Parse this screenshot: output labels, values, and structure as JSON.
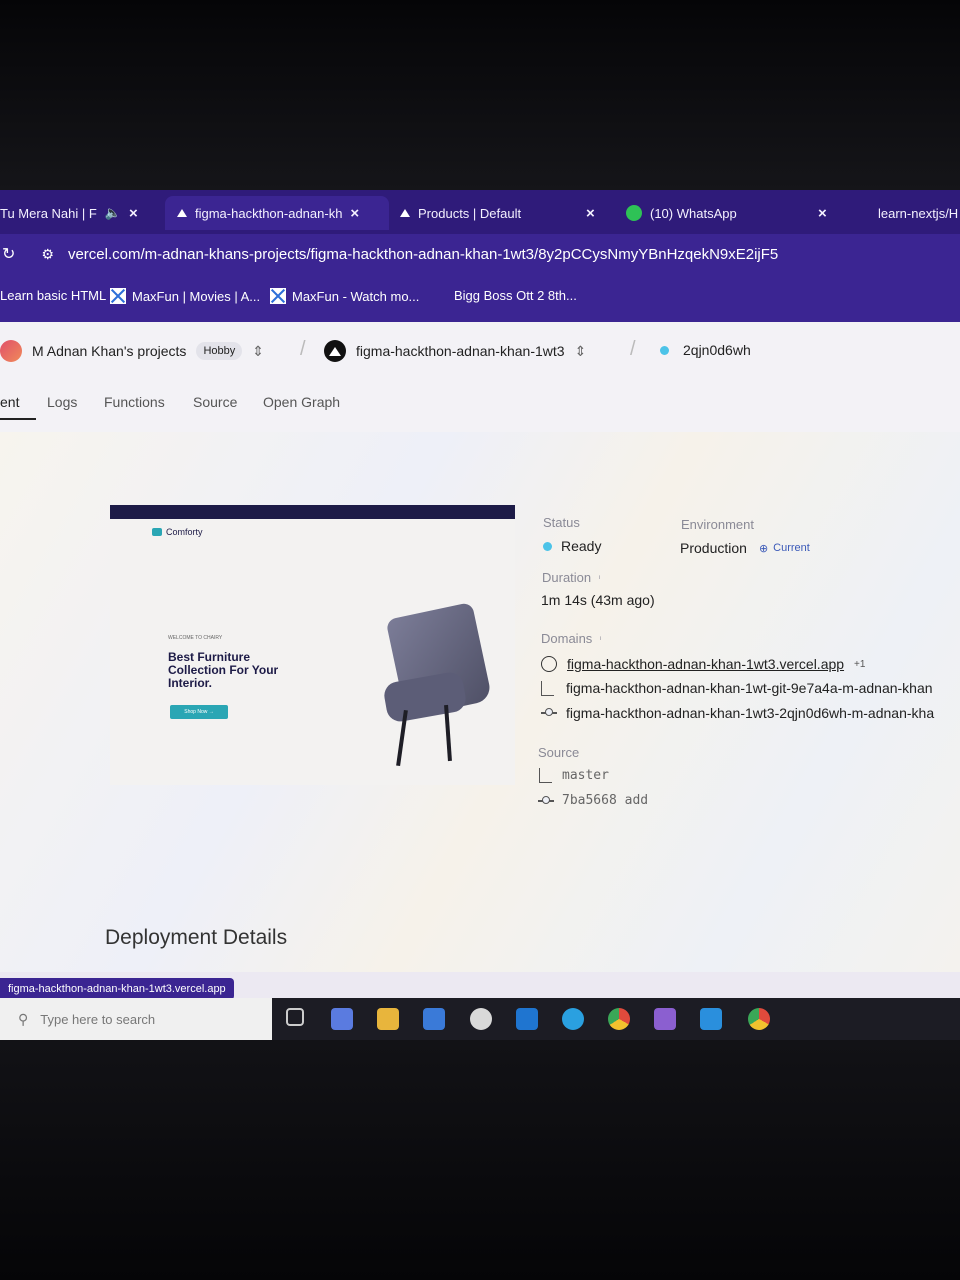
{
  "tabs": [
    {
      "title": "Tu Mera Nahi | F",
      "close": "×",
      "icon": "speaker-icon"
    },
    {
      "title": "figma-hackthon-adnan-kh",
      "close": "×",
      "icon": "vercel-icon"
    },
    {
      "title": "Products | Default",
      "close": "×",
      "icon": "vercel-icon"
    },
    {
      "title": "(10) WhatsApp",
      "close": "×",
      "icon": "whatsapp-icon"
    },
    {
      "title": "learn-nextjs/H"
    }
  ],
  "address": {
    "url": "vercel.com/m-adnan-khans-projects/figma-hackthon-adnan-khan-1wt3/8y2pCCysNmyYBnHzqekN9xE2ijF5"
  },
  "bookmarks": [
    {
      "label": "Learn basic HTML"
    },
    {
      "label": "MaxFun | Movies | A..."
    },
    {
      "label": "MaxFun - Watch mo..."
    },
    {
      "label": "Bigg Boss Ott 2 8th..."
    }
  ],
  "header": {
    "team": "M Adnan Khan's projects",
    "plan": "Hobby",
    "project": "figma-hackthon-adnan-khan-1wt3",
    "deployment_id": "2qjn0d6wh"
  },
  "nav": [
    "ent",
    "Logs",
    "Functions",
    "Source",
    "Open Graph"
  ],
  "preview": {
    "brand": "Comforty",
    "welcome": "WELCOME TO CHAIRY",
    "headline": "Best Furniture Collection For Your Interior.",
    "cta": "Shop Now →"
  },
  "status": {
    "label": "Status",
    "value": "Ready"
  },
  "environment": {
    "label": "Environment",
    "value": "Production",
    "badge": "Current"
  },
  "duration": {
    "label": "Duration",
    "value": "1m 14s (43m ago)"
  },
  "domains": {
    "label": "Domains",
    "items": [
      "figma-hackthon-adnan-khan-1wt3.vercel.app",
      "figma-hackthon-adnan-khan-1wt-git-9e7a4a-m-adnan-khan",
      "figma-hackthon-adnan-khan-1wt3-2qjn0d6wh-m-adnan-kha"
    ],
    "extra": "+1"
  },
  "source": {
    "label": "Source",
    "branch": "master",
    "commit": "7ba5668 add"
  },
  "details": {
    "title": "Deployment Details"
  },
  "hover_url": "figma-hackthon-adnan-khan-1wt3.vercel.app",
  "taskbar": {
    "search_placeholder": "Type here to search"
  },
  "colors": {
    "browser_chrome": "#3b2592",
    "status_ready": "#4cc3e8",
    "preview_nav": "#1d1b47"
  }
}
